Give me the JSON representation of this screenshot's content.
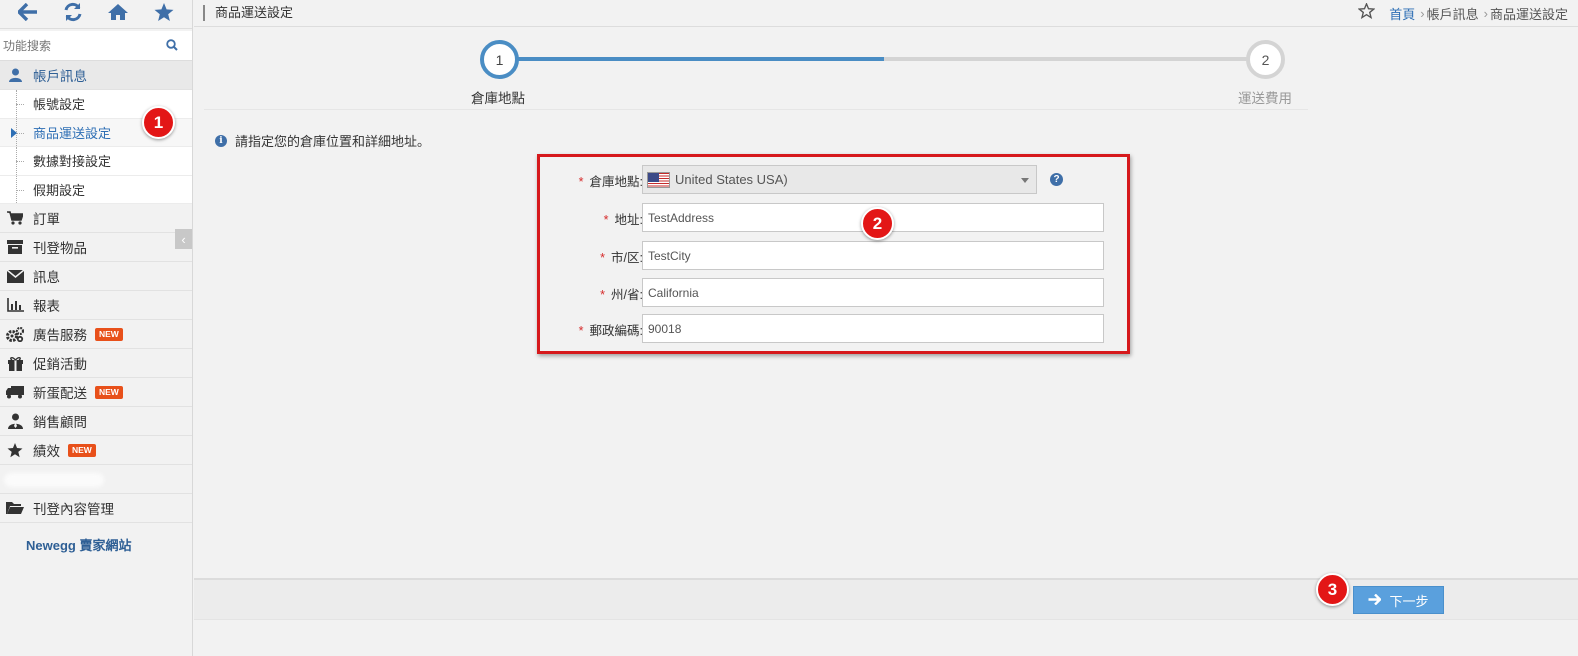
{
  "sidebar": {
    "top_icons": [
      "back-icon",
      "refresh-icon",
      "home-icon",
      "star-icon"
    ],
    "search_placeholder": "功能搜索",
    "account": {
      "label": "帳戶訊息",
      "sub_items": [
        "帳號設定",
        "商品運送設定",
        "數據對接設定",
        "假期設定"
      ],
      "active_index": 1
    },
    "items": [
      {
        "label": "訂單",
        "icon": "cart-icon"
      },
      {
        "label": "刊登物品",
        "icon": "archive-icon"
      },
      {
        "label": "訊息",
        "icon": "envelope-icon"
      },
      {
        "label": "報表",
        "icon": "bar-chart-icon"
      },
      {
        "label": "廣告服務",
        "icon": "gears-icon",
        "badge": "NEW"
      },
      {
        "label": "促銷活動",
        "icon": "gift-icon"
      },
      {
        "label": "新蛋配送",
        "icon": "truck-icon",
        "badge": "NEW"
      },
      {
        "label": "銷售顧問",
        "icon": "user-tie-icon"
      },
      {
        "label": "績效",
        "icon": "star-icon",
        "badge": "NEW"
      },
      {
        "label": "刊登內容管理",
        "icon": "folder-open-icon"
      }
    ],
    "footer_link": "Newegg 賣家網站"
  },
  "header": {
    "page_title": "商品運送設定",
    "breadcrumb": [
      "首頁",
      "帳戶訊息",
      "商品運送設定"
    ]
  },
  "steps": [
    {
      "number": "1",
      "label": "倉庫地點"
    },
    {
      "number": "2",
      "label": "運送費用"
    }
  ],
  "step_progress": 0.5,
  "info_text": "請指定您的倉庫位置和詳細地址。",
  "form": {
    "warehouse_label": "倉庫地點:",
    "warehouse_value": "United States USA)",
    "address_label": "地址:",
    "address_value": "TestAddress",
    "city_label": "市/区:",
    "city_value": "TestCity",
    "state_label": "州/省:",
    "state_value": "California",
    "zip_label": "郵政編碼:",
    "zip_value": "90018",
    "required_mark": "*"
  },
  "markers": [
    "1",
    "2",
    "3"
  ],
  "next_button": "下一步",
  "colors": {
    "accent": "#3f6fa8",
    "link": "#2e6fb5",
    "step_active": "#4a8dc4",
    "highlight_border": "#d6191c",
    "marker": "#e31616",
    "button": "#5aa0dd",
    "badge": "#e8501a"
  }
}
